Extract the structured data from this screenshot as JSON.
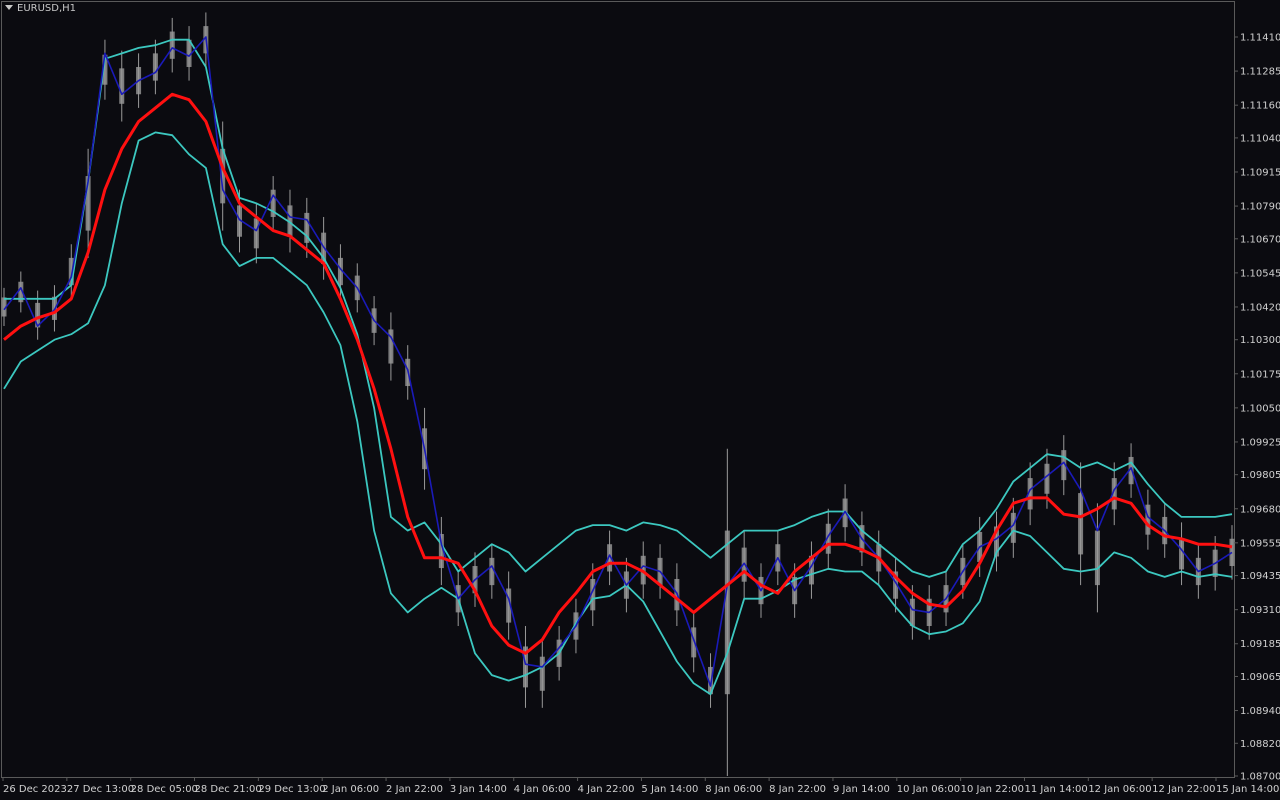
{
  "window": {
    "symbol": "EURUSD,H1"
  },
  "colors": {
    "background": "#0b0b10",
    "axis_text": "#d0d0d0",
    "frame": "#5a5a5a",
    "candle": "#9a9a9a",
    "price_line": "#1a1ab8",
    "bands": "#3cc8c0",
    "middle_ma": "#ff1010"
  },
  "chart_data": {
    "type": "line",
    "title": "EURUSD,H1",
    "xlabel": "",
    "ylabel": "",
    "ylim": [
      1.087,
      1.115
    ],
    "grid": false,
    "y_ticks": [
      "1.11410",
      "1.11285",
      "1.11160",
      "1.11040",
      "1.10915",
      "1.10790",
      "1.10670",
      "1.10545",
      "1.10420",
      "1.10300",
      "1.10175",
      "1.10050",
      "1.09925",
      "1.09805",
      "1.09680",
      "1.09555",
      "1.09435",
      "1.09310",
      "1.09185",
      "1.09065",
      "1.08940",
      "1.08820",
      "1.08700"
    ],
    "x_labels": [
      "26 Dec 2023",
      "27 Dec 13:00",
      "28 Dec 05:00",
      "28 Dec 21:00",
      "29 Dec 13:00",
      "2 Jan 06:00",
      "2 Jan 22:00",
      "3 Jan 14:00",
      "4 Jan 06:00",
      "4 Jan 22:00",
      "5 Jan 14:00",
      "8 Jan 06:00",
      "8 Jan 22:00",
      "9 Jan 14:00",
      "10 Jan 06:00",
      "10 Jan 22:00",
      "11 Jan 14:00",
      "12 Jan 06:00",
      "12 Jan 22:00",
      "15 Jan 14:00"
    ],
    "series": [
      {
        "name": "",
        "role": "price",
        "values": [
          1.1041,
          1.1049,
          1.1035,
          1.1041,
          1.1053,
          1.1088,
          1.1135,
          1.112,
          1.1125,
          1.1128,
          1.1137,
          1.1134,
          1.1141,
          1.1085,
          1.1074,
          1.107,
          1.1083,
          1.1075,
          1.1074,
          1.1064,
          1.1056,
          1.1049,
          1.1037,
          1.1031,
          1.1019,
          1.099,
          1.0955,
          1.0935,
          1.0942,
          1.0947,
          1.0935,
          1.0911,
          1.091,
          1.0917,
          1.0925,
          1.0938,
          1.0951,
          1.094,
          1.0947,
          1.0945,
          1.0937,
          1.092,
          1.0903,
          1.094,
          1.0948,
          1.0938,
          1.095,
          1.0938,
          1.0947,
          1.0958,
          1.0967,
          1.0957,
          1.095,
          1.0941,
          1.0931,
          1.093,
          1.0935,
          1.0945,
          1.0954,
          1.0957,
          1.0962,
          1.0975,
          1.098,
          1.0985,
          1.0975,
          1.096,
          1.0975,
          1.0983,
          1.0965,
          1.096,
          1.0953,
          1.0945,
          1.0948,
          1.0952
        ]
      },
      {
        "name": "",
        "role": "upper_band",
        "values": [
          1.1045,
          1.1045,
          1.1045,
          1.1045,
          1.105,
          1.1088,
          1.1133,
          1.1135,
          1.1137,
          1.1138,
          1.114,
          1.114,
          1.113,
          1.11,
          1.1082,
          1.108,
          1.1077,
          1.1073,
          1.1068,
          1.106,
          1.1049,
          1.1032,
          1.1005,
          1.0965,
          1.096,
          1.0963,
          1.0955,
          1.0945,
          1.095,
          1.0955,
          1.0952,
          1.0945,
          1.095,
          1.0955,
          1.096,
          1.0962,
          1.0962,
          1.096,
          1.0963,
          1.0962,
          1.096,
          1.0955,
          1.095,
          1.0955,
          1.096,
          1.096,
          1.096,
          1.0962,
          1.0965,
          1.0967,
          1.0967,
          1.096,
          1.0955,
          1.095,
          1.0945,
          1.0943,
          1.0945,
          1.0955,
          1.096,
          1.0968,
          1.0978,
          1.0983,
          1.0988,
          1.0987,
          1.0983,
          1.0985,
          1.0982,
          1.0985,
          1.0977,
          1.097,
          1.0965,
          1.0965,
          1.0965,
          1.0966
        ]
      },
      {
        "name": "",
        "role": "middle_ma",
        "values": [
          1.103,
          1.1035,
          1.1038,
          1.104,
          1.1045,
          1.1062,
          1.1085,
          1.11,
          1.111,
          1.1115,
          1.112,
          1.1118,
          1.111,
          1.1093,
          1.108,
          1.1075,
          1.107,
          1.1068,
          1.1063,
          1.1058,
          1.1045,
          1.103,
          1.1012,
          1.099,
          1.0965,
          1.095,
          1.095,
          1.0948,
          1.0938,
          1.0925,
          1.0918,
          1.0915,
          1.092,
          1.093,
          1.0937,
          1.0945,
          1.0948,
          1.0948,
          1.0945,
          1.094,
          1.0935,
          1.093,
          1.0935,
          1.094,
          1.0945,
          1.094,
          1.0937,
          1.0945,
          1.095,
          1.0955,
          1.0955,
          1.0953,
          1.095,
          1.0943,
          1.0937,
          1.0933,
          1.0932,
          1.0938,
          1.0948,
          1.096,
          1.097,
          1.0972,
          1.0972,
          1.0966,
          1.0965,
          1.0968,
          1.0972,
          1.097,
          1.0962,
          1.0958,
          1.0957,
          1.0955,
          1.0955,
          1.0954
        ]
      },
      {
        "name": "",
        "role": "lower_band",
        "values": [
          1.1012,
          1.1022,
          1.1026,
          1.103,
          1.1032,
          1.1036,
          1.105,
          1.108,
          1.1103,
          1.1106,
          1.1105,
          1.1098,
          1.1093,
          1.1065,
          1.1057,
          1.106,
          1.106,
          1.1055,
          1.105,
          1.104,
          1.1028,
          1.1,
          1.096,
          1.0937,
          1.093,
          1.0935,
          1.0939,
          1.0935,
          1.0915,
          1.0907,
          1.0905,
          1.0907,
          1.091,
          1.0915,
          1.0926,
          1.0935,
          1.0936,
          1.094,
          1.0934,
          1.0923,
          1.0912,
          1.0904,
          1.09,
          1.0915,
          1.0935,
          1.0935,
          1.0938,
          1.0942,
          1.0944,
          1.0946,
          1.0945,
          1.0945,
          1.094,
          1.0932,
          1.0925,
          1.0922,
          1.0923,
          1.0926,
          1.0934,
          1.0952,
          1.096,
          1.0958,
          1.0952,
          1.0946,
          1.0945,
          1.0946,
          1.0952,
          1.095,
          1.0945,
          1.0943,
          1.0945,
          1.0943,
          1.0944,
          1.0943
        ]
      }
    ],
    "candles": {
      "name": "",
      "high_low": [
        [
          1.1049,
          1.1035
        ],
        [
          1.1055,
          1.104
        ],
        [
          1.1048,
          1.103
        ],
        [
          1.105,
          1.1033
        ],
        [
          1.1065,
          1.1045
        ],
        [
          1.11,
          1.106
        ],
        [
          1.114,
          1.1118
        ],
        [
          1.1136,
          1.111
        ],
        [
          1.1135,
          1.1115
        ],
        [
          1.114,
          1.112
        ],
        [
          1.1148,
          1.1128
        ],
        [
          1.1145,
          1.1125
        ],
        [
          1.115,
          1.113
        ],
        [
          1.111,
          1.107
        ],
        [
          1.1085,
          1.1062
        ],
        [
          1.108,
          1.1058
        ],
        [
          1.109,
          1.107
        ],
        [
          1.1085,
          1.1062
        ],
        [
          1.1082,
          1.106
        ],
        [
          1.1075,
          1.1052
        ],
        [
          1.1065,
          1.1045
        ],
        [
          1.1058,
          1.104
        ],
        [
          1.1046,
          1.1028
        ],
        [
          1.104,
          1.1015
        ],
        [
          1.1028,
          1.1008
        ],
        [
          1.1005,
          1.0975
        ],
        [
          1.0965,
          1.094
        ],
        [
          1.0945,
          1.0925
        ],
        [
          1.0952,
          1.0932
        ],
        [
          1.0955,
          1.0935
        ],
        [
          1.0945,
          1.092
        ],
        [
          1.0925,
          1.0895
        ],
        [
          1.092,
          1.0895
        ],
        [
          1.0925,
          1.0905
        ],
        [
          1.0935,
          1.0915
        ],
        [
          1.0948,
          1.0925
        ],
        [
          1.096,
          1.094
        ],
        [
          1.095,
          1.093
        ],
        [
          1.0956,
          1.0935
        ],
        [
          1.0955,
          1.0935
        ],
        [
          1.0948,
          1.0925
        ],
        [
          1.093,
          1.0908
        ],
        [
          1.0915,
          1.0895
        ],
        [
          1.099,
          1.087
        ],
        [
          1.096,
          1.0935
        ],
        [
          1.0948,
          1.0928
        ],
        [
          1.096,
          1.094
        ],
        [
          1.0948,
          1.0928
        ],
        [
          1.0956,
          1.0935
        ],
        [
          1.0968,
          1.0946
        ],
        [
          1.0977,
          1.0956
        ],
        [
          1.0967,
          1.0947
        ],
        [
          1.096,
          1.094
        ],
        [
          1.095,
          1.093
        ],
        [
          1.094,
          1.092
        ],
        [
          1.094,
          1.092
        ],
        [
          1.0945,
          1.0925
        ],
        [
          1.0955,
          1.0935
        ],
        [
          1.0965,
          1.0943
        ],
        [
          1.0967,
          1.0945
        ],
        [
          1.0972,
          1.095
        ],
        [
          1.0985,
          1.0962
        ],
        [
          1.099,
          1.0968
        ],
        [
          1.0995,
          1.0973
        ],
        [
          1.0985,
          1.094
        ],
        [
          1.097,
          1.093
        ],
        [
          1.0985,
          1.0962
        ],
        [
          1.0992,
          1.0972
        ],
        [
          1.0975,
          1.0953
        ],
        [
          1.097,
          1.095
        ],
        [
          1.0963,
          1.094
        ],
        [
          1.0955,
          1.0935
        ],
        [
          1.0958,
          1.0938
        ],
        [
          1.0962,
          1.0942
        ]
      ]
    }
  }
}
